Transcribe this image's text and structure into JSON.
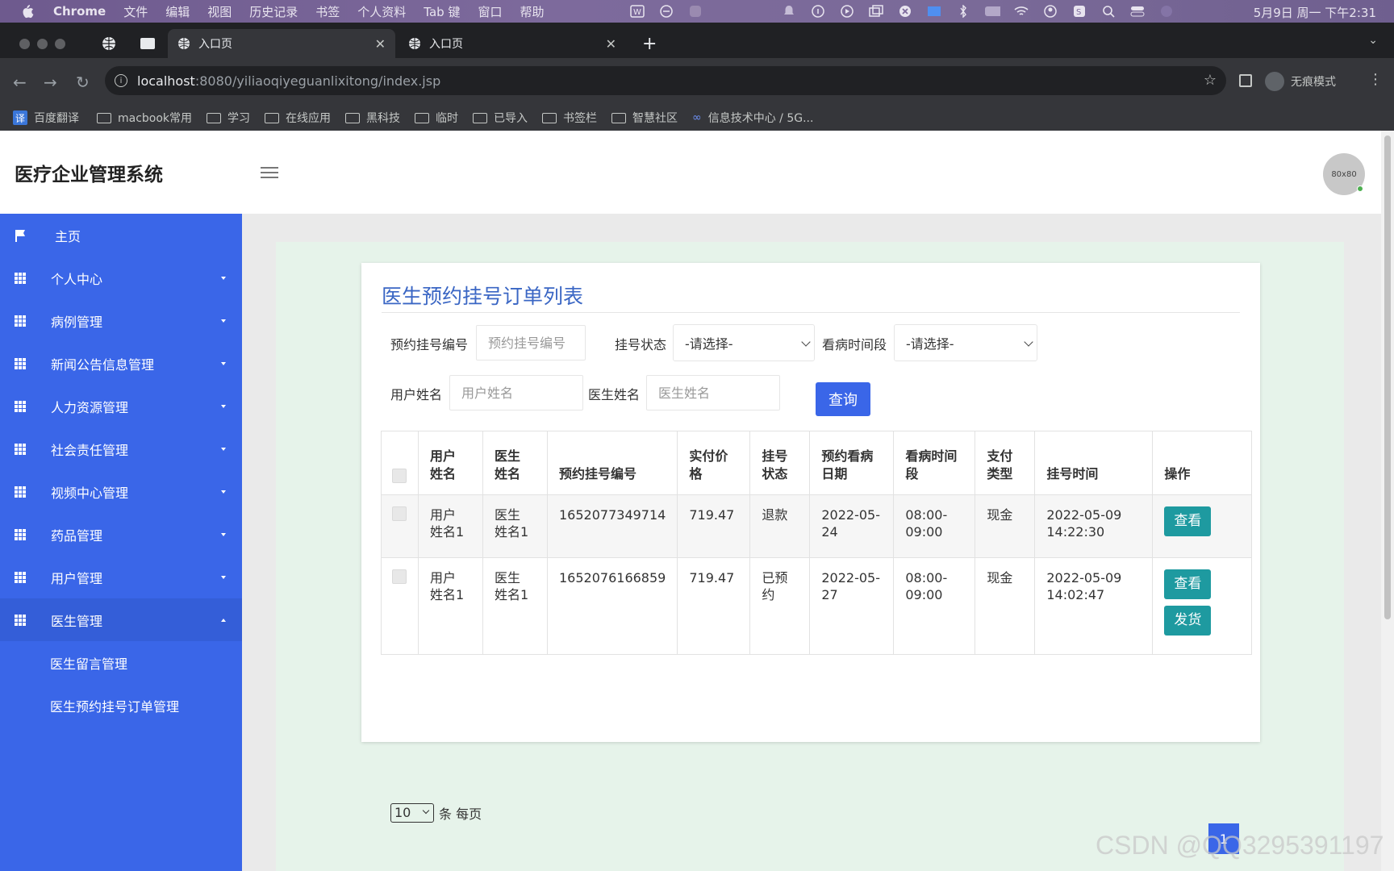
{
  "menubar": {
    "app": "Chrome",
    "items": [
      "文件",
      "编辑",
      "视图",
      "历史记录",
      "书签",
      "个人资料",
      "Tab 键",
      "窗口",
      "帮助"
    ],
    "clock": "5月9日 周一 下午2:31"
  },
  "browser": {
    "tabs": [
      {
        "title": "入口页",
        "active": true
      },
      {
        "title": "入口页",
        "active": false
      }
    ],
    "url_host": "localhost",
    "url_path": ":8080/yiliaoqiyeguanlixitong/index.jsp",
    "incognito_label": "无痕模式",
    "bookmarks": [
      {
        "label": "百度翻译",
        "icon": "translate-icon"
      },
      {
        "label": "macbook常用",
        "icon": "folder-icon"
      },
      {
        "label": "学习",
        "icon": "folder-icon"
      },
      {
        "label": "在线应用",
        "icon": "folder-icon"
      },
      {
        "label": "黑科技",
        "icon": "folder-icon"
      },
      {
        "label": "临时",
        "icon": "folder-icon"
      },
      {
        "label": "已导入",
        "icon": "folder-icon"
      },
      {
        "label": "书签栏",
        "icon": "folder-icon"
      },
      {
        "label": "智慧社区",
        "icon": "folder-icon"
      },
      {
        "label": "信息技术中心 / 5G...",
        "icon": "link-icon"
      }
    ]
  },
  "header": {
    "title": "医疗企业管理系统",
    "avatar_text": "80x80"
  },
  "sidebar": {
    "items": [
      {
        "label": "主页",
        "icon": "flag-icon"
      },
      {
        "label": "个人中心",
        "icon": "grid-icon"
      },
      {
        "label": "病例管理",
        "icon": "grid-icon"
      },
      {
        "label": "新闻公告信息管理",
        "icon": "grid-icon"
      },
      {
        "label": "人力资源管理",
        "icon": "grid-icon"
      },
      {
        "label": "社会责任管理",
        "icon": "grid-icon"
      },
      {
        "label": "视频中心管理",
        "icon": "grid-icon"
      },
      {
        "label": "药品管理",
        "icon": "grid-icon"
      },
      {
        "label": "用户管理",
        "icon": "grid-icon"
      },
      {
        "label": "医生管理",
        "icon": "grid-icon"
      }
    ],
    "sub_items": [
      "医生留言管理",
      "医生预约挂号订单管理"
    ]
  },
  "main": {
    "title": "医生预约挂号订单列表",
    "filters": {
      "order_no_label": "预约挂号编号",
      "order_no_placeholder": "预约挂号编号",
      "status_label": "挂号状态",
      "status_value": "-请选择-",
      "period_label": "看病时间段",
      "period_value": "-请选择-",
      "user_label": "用户姓名",
      "user_placeholder": "用户姓名",
      "doctor_label": "医生姓名",
      "doctor_placeholder": "医生姓名",
      "query_button": "查询"
    },
    "table": {
      "headers": [
        "用户\n姓名",
        "医生\n姓名",
        "预约挂号编号",
        "实付价\n格",
        "挂号\n状态",
        "预约看病\n日期",
        "看病时间\n段",
        "支付\n类型",
        "挂号时间",
        "操作"
      ],
      "rows": [
        {
          "user": "用户\n姓名1",
          "doctor": "医生\n姓名1",
          "order_no": "1652077349714",
          "price": "719.47",
          "status": "退款",
          "date": "2022-05-\n24",
          "period": "08:00-\n09:00",
          "pay": "现金",
          "time": "2022-05-09\n14:22:30",
          "actions": [
            "查看"
          ]
        },
        {
          "user": "用户\n姓名1",
          "doctor": "医生\n姓名1",
          "order_no": "1652076166859",
          "price": "719.47",
          "status": "已预\n约",
          "date": "2022-05-\n27",
          "period": "08:00-\n09:00",
          "pay": "现金",
          "time": "2022-05-09\n14:02:47",
          "actions": [
            "查看",
            "发货"
          ]
        }
      ]
    },
    "pagination": {
      "page_size": "10",
      "page_size_unit": "条 每页",
      "current_page": "1"
    }
  },
  "watermark": "CSDN @QQ3295391197"
}
